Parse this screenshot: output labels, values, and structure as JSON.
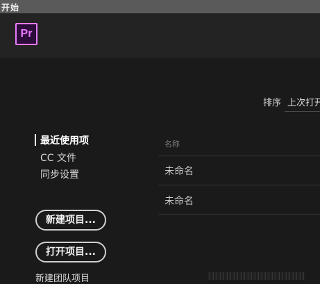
{
  "window": {
    "title": "开始"
  },
  "logo": {
    "text": "Pr"
  },
  "sort": {
    "label": "排序",
    "value": "上次打开"
  },
  "nav": {
    "items": [
      {
        "label": "最近使用项",
        "active": true
      },
      {
        "label": "CC 文件",
        "active": false
      },
      {
        "label": "同步设置",
        "active": false
      }
    ]
  },
  "actions": {
    "new_project": "新建项目...",
    "open_project": "打开项目...",
    "new_team_project": "新建团队项目"
  },
  "recent": {
    "column_name": "名称",
    "rows": [
      "未命名",
      "未命名"
    ]
  }
}
